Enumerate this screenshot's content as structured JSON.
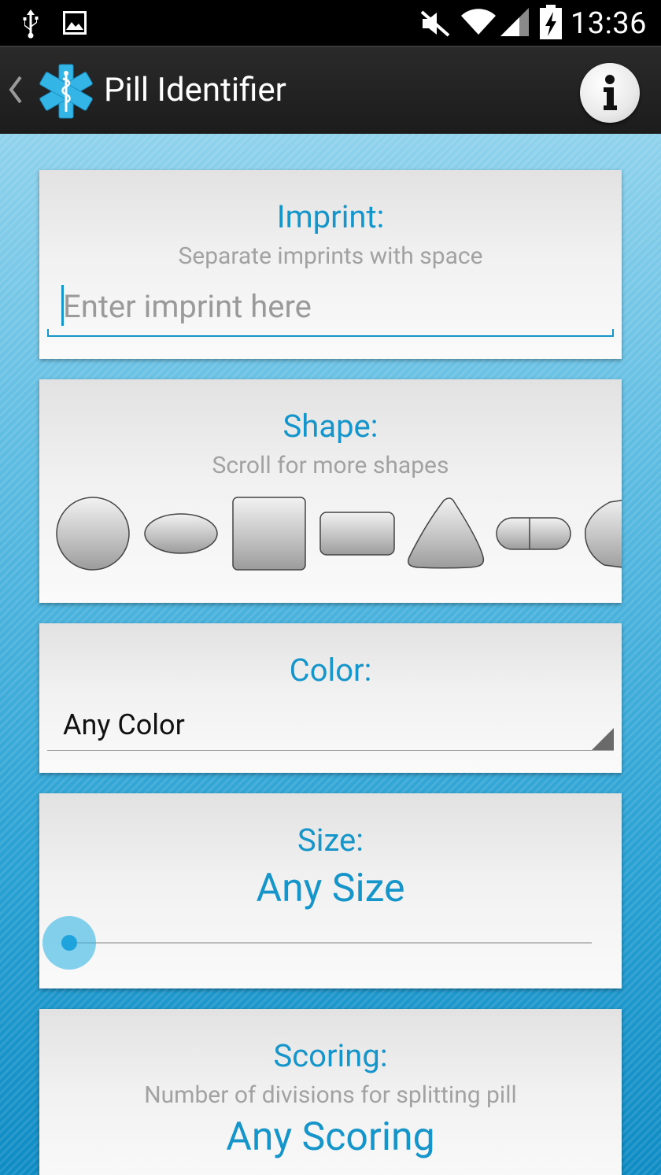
{
  "status_bar": {
    "time": "13:36",
    "icons": [
      "usb-icon",
      "image-icon",
      "mute-icon",
      "wifi-icon",
      "signal-icon",
      "battery-charging-icon"
    ]
  },
  "action_bar": {
    "title": "Pill Identifier",
    "back_icon": "chevron-left-icon",
    "logo_icon": "star-of-life-icon",
    "info_icon": "info-icon"
  },
  "imprint": {
    "title": "Imprint:",
    "subtitle": "Separate imprints with space",
    "placeholder": "Enter imprint here",
    "value": ""
  },
  "shape": {
    "title": "Shape:",
    "subtitle": "Scroll for more shapes",
    "options": [
      "round",
      "oval",
      "square",
      "rectangle",
      "triangle",
      "capsule",
      "pentagon"
    ]
  },
  "color": {
    "title": "Color:",
    "selected": "Any Color"
  },
  "size": {
    "title": "Size:",
    "value": "Any Size",
    "slider_level": 0
  },
  "scoring": {
    "title": "Scoring:",
    "subtitle": "Number of divisions for splitting pill",
    "value": "Any Scoring"
  },
  "colors": {
    "accent": "#1595c9",
    "action_bar": "#222222",
    "background": "#49b3dc"
  }
}
